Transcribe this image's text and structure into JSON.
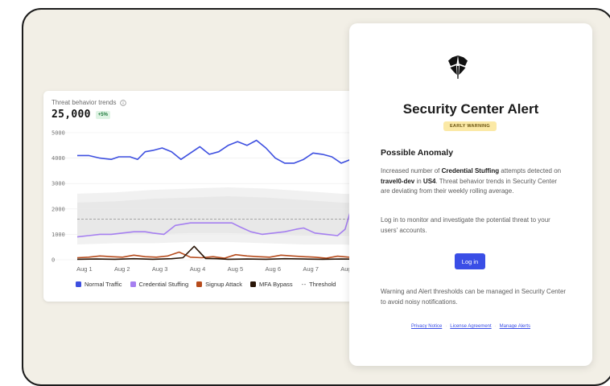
{
  "chart_card": {
    "title": "Threat behavior trends",
    "value": "25,000",
    "badge": "+5%"
  },
  "chart_data": {
    "type": "line",
    "title": "Threat behavior trends",
    "x": [
      "Aug 1",
      "Aug 2",
      "Aug 3",
      "Aug 4",
      "Aug 5",
      "Aug 6",
      "Aug 7",
      "Aug 8"
    ],
    "y_ticks": [
      "5000",
      "4000",
      "3000",
      "2000",
      "1000",
      "0"
    ],
    "ylim": [
      0,
      5000
    ],
    "xlim": [
      0,
      8
    ],
    "legend_placement": "bottom",
    "series": [
      {
        "name": "Normal Traffic",
        "color": "#3d4fe0",
        "points": [
          [
            0,
            4100
          ],
          [
            0.3,
            4100
          ],
          [
            0.6,
            4000
          ],
          [
            0.9,
            3950
          ],
          [
            1.1,
            4050
          ],
          [
            1.4,
            4050
          ],
          [
            1.6,
            3950
          ],
          [
            1.8,
            4250
          ],
          [
            2.0,
            4300
          ],
          [
            2.25,
            4400
          ],
          [
            2.5,
            4250
          ],
          [
            2.75,
            3950
          ],
          [
            3.0,
            4200
          ],
          [
            3.25,
            4450
          ],
          [
            3.5,
            4150
          ],
          [
            3.75,
            4250
          ],
          [
            4.0,
            4500
          ],
          [
            4.25,
            4650
          ],
          [
            4.5,
            4500
          ],
          [
            4.75,
            4700
          ],
          [
            5.0,
            4400
          ],
          [
            5.25,
            4000
          ],
          [
            5.5,
            3800
          ],
          [
            5.75,
            3800
          ],
          [
            6.0,
            3950
          ],
          [
            6.25,
            4200
          ],
          [
            6.5,
            4150
          ],
          [
            6.75,
            4050
          ],
          [
            7.0,
            3800
          ],
          [
            7.25,
            3950
          ],
          [
            7.5,
            4150
          ],
          [
            7.75,
            4200
          ],
          [
            8.0,
            4050
          ]
        ]
      },
      {
        "name": "Credential Stuffing",
        "color": "#a57ff0",
        "points": [
          [
            0,
            900
          ],
          [
            0.3,
            950
          ],
          [
            0.6,
            1000
          ],
          [
            0.9,
            1000
          ],
          [
            1.2,
            1050
          ],
          [
            1.5,
            1100
          ],
          [
            1.8,
            1100
          ],
          [
            2.0,
            1050
          ],
          [
            2.3,
            1000
          ],
          [
            2.6,
            1350
          ],
          [
            3.0,
            1450
          ],
          [
            3.3,
            1450
          ],
          [
            3.6,
            1450
          ],
          [
            3.9,
            1450
          ],
          [
            4.1,
            1450
          ],
          [
            4.3,
            1300
          ],
          [
            4.6,
            1100
          ],
          [
            4.9,
            1000
          ],
          [
            5.2,
            1050
          ],
          [
            5.5,
            1100
          ],
          [
            5.8,
            1200
          ],
          [
            6.0,
            1250
          ],
          [
            6.3,
            1050
          ],
          [
            6.6,
            1000
          ],
          [
            6.9,
            950
          ],
          [
            7.1,
            1200
          ],
          [
            7.3,
            2200
          ],
          [
            7.5,
            2100
          ],
          [
            7.7,
            2250
          ],
          [
            7.9,
            2900
          ],
          [
            8.1,
            3100
          ],
          [
            8.3,
            3050
          ]
        ]
      },
      {
        "name": "Signup Attack",
        "color": "#b64b1c",
        "points": [
          [
            0,
            80
          ],
          [
            0.3,
            100
          ],
          [
            0.6,
            150
          ],
          [
            0.9,
            120
          ],
          [
            1.2,
            100
          ],
          [
            1.5,
            180
          ],
          [
            1.8,
            120
          ],
          [
            2.1,
            100
          ],
          [
            2.4,
            150
          ],
          [
            2.7,
            300
          ],
          [
            3.0,
            100
          ],
          [
            3.3,
            80
          ],
          [
            3.6,
            120
          ],
          [
            3.9,
            60
          ],
          [
            4.2,
            200
          ],
          [
            4.5,
            150
          ],
          [
            4.8,
            120
          ],
          [
            5.1,
            100
          ],
          [
            5.4,
            180
          ],
          [
            5.7,
            150
          ],
          [
            6.0,
            120
          ],
          [
            6.3,
            100
          ],
          [
            6.6,
            60
          ],
          [
            6.9,
            140
          ],
          [
            7.2,
            100
          ],
          [
            7.5,
            80
          ],
          [
            8.0,
            100
          ]
        ]
      },
      {
        "name": "MFA Bypass",
        "color": "#2a1608",
        "points": [
          [
            0,
            20
          ],
          [
            0.5,
            30
          ],
          [
            1.0,
            20
          ],
          [
            1.5,
            40
          ],
          [
            2.0,
            20
          ],
          [
            2.5,
            40
          ],
          [
            2.8,
            80
          ],
          [
            3.1,
            530
          ],
          [
            3.4,
            50
          ],
          [
            3.7,
            40
          ],
          [
            4.0,
            20
          ],
          [
            4.5,
            30
          ],
          [
            5.0,
            20
          ],
          [
            5.5,
            40
          ],
          [
            6.0,
            30
          ],
          [
            6.5,
            20
          ],
          [
            7.0,
            30
          ],
          [
            7.5,
            20
          ],
          [
            8.0,
            20
          ]
        ]
      }
    ],
    "threshold": {
      "name": "Threshold",
      "value": 1600
    }
  },
  "legend": [
    {
      "label": "Normal Traffic",
      "color": "#3d4fe0",
      "kind": "box"
    },
    {
      "label": "Credential Stuffing",
      "color": "#a57ff0",
      "kind": "box"
    },
    {
      "label": "Signup Attack",
      "color": "#b64b1c",
      "kind": "box"
    },
    {
      "label": "MFA Bypass",
      "color": "#2a1608",
      "kind": "box"
    },
    {
      "label": "Threshold",
      "color": "#444444",
      "kind": "dash"
    }
  ],
  "alert": {
    "title": "Security Center Alert",
    "badge": "EARLY WARNING",
    "heading": "Possible Anomaly",
    "p1": {
      "t1": "Increased number of ",
      "b1": "Credential Stuffing",
      "t2": " attempts detected on ",
      "b2": "travel0-dev",
      "t3": " in ",
      "b3": "US4",
      "t4": ". Threat behavior trends in Security Center are deviating from their weekly rolling average."
    },
    "p2": "Log in to monitor and investigate the potential threat to your users' accounts.",
    "login_label": "Log in",
    "p3": "Warning and Alert thresholds can be managed in Security Center to avoid noisy notifications.",
    "links": {
      "privacy": "Privacy Notice",
      "license": "License Agreement",
      "alerts": "Manage Alerts",
      "separator": "·"
    }
  },
  "colors": {
    "accent": "#3a4ee6",
    "frame_background": "#f2efe6",
    "warning_badge": "#fbe9a6",
    "positive_badge": "#dff3e4"
  },
  "icons": {
    "logo": "shield-icon",
    "info": "info-icon"
  }
}
